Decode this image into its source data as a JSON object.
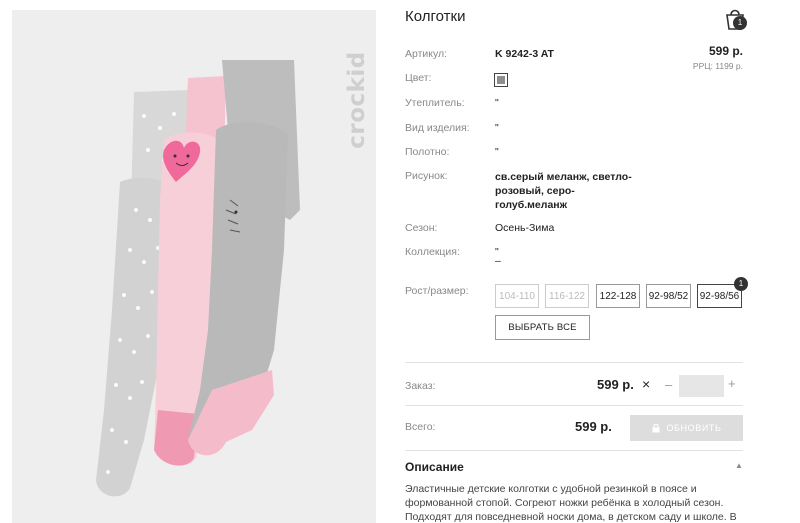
{
  "product": {
    "title": "Колготки",
    "brand": "crockid"
  },
  "cart": {
    "count": "1"
  },
  "price": {
    "main": "599 р.",
    "rrc": "РРЦ: 1199 р."
  },
  "attributes": {
    "article_label": "Артикул:",
    "article_value": "K 9242-3 AT",
    "color_label": "Цвет:",
    "color_swatch": "#8e8e8e",
    "warming_label": "Утеплитель:",
    "warming_value": "\"",
    "type_label": "Вид изделия:",
    "type_value": "\"",
    "fabric_label": "Полотно:",
    "fabric_value": "\"",
    "pattern_label": "Рисунок:",
    "pattern_value": "св.серый меланж, светло-розовый, серо-голуб.меланж",
    "season_label": "Сезон:",
    "season_value": "Осень-Зима",
    "collection_label": "Коллекция:",
    "collection_value": "\"",
    "collection_value2": "–"
  },
  "sizes": {
    "label": "Рост/размер:",
    "options": [
      "104-110",
      "116-122",
      "122-128",
      "92-98/52",
      "92-98/56"
    ],
    "selected_count": "1",
    "select_all": "ВЫБРАТЬ ВСЕ"
  },
  "order": {
    "label": "Заказ:",
    "price": "599 р.",
    "remove_icon": "×",
    "minus": "–",
    "plus": "+",
    "total_label": "Всего:",
    "total_price": "599 р.",
    "update_button": "ОБНОВИТЬ"
  },
  "description": {
    "title": "Описание",
    "text": "Эластичные детские колготки с удобной резинкой в поясе и формованной стопой. Согреют ножки ребёнка в холодный сезон. Подходят для повседневной носки дома, в детском саду и школе. В"
  },
  "colors": {
    "accent": "#333333",
    "photo_bg": "#eeeeee",
    "tights_grey": "#b9b9b9",
    "tights_pink": "#f7cfd8",
    "heart_pink": "#ef6a9a"
  }
}
